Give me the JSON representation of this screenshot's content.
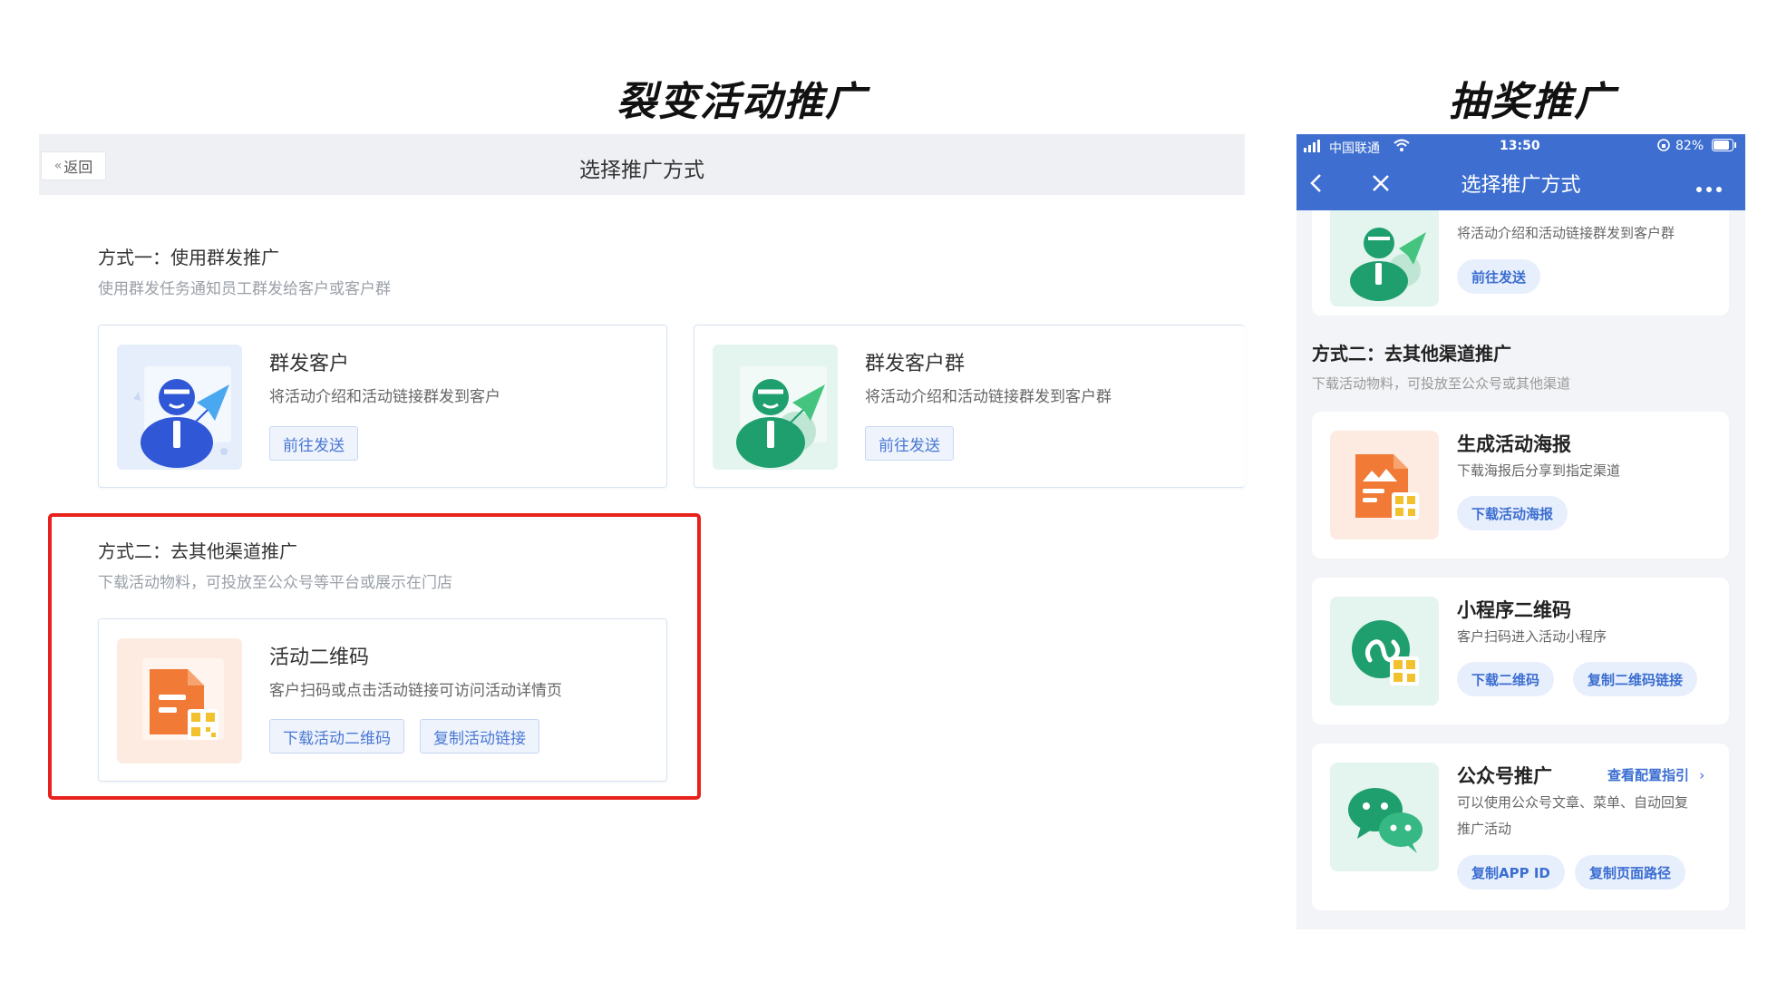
{
  "headings": {
    "left": "裂变活动推广",
    "right": "抽奖推广"
  },
  "web": {
    "back_label": "返回",
    "title": "选择推广方式",
    "method1": {
      "title": "方式一：使用群发推广",
      "desc": "使用群发任务通知员工群发给客户或客户群",
      "cards": [
        {
          "title": "群发客户",
          "desc": "将活动介绍和活动链接群发到客户",
          "button": "前往发送"
        },
        {
          "title": "群发客户群",
          "desc": "将活动介绍和活动链接群发到客户群",
          "button": "前往发送"
        }
      ]
    },
    "method2": {
      "title": "方式二：去其他渠道推广",
      "desc": "下载活动物料，可投放至公众号等平台或展示在门店",
      "card": {
        "title": "活动二维码",
        "desc": "客户扫码或点击活动链接可访问活动详情页",
        "buttons": [
          "下载活动二维码",
          "复制活动链接"
        ]
      }
    }
  },
  "phone": {
    "status": {
      "carrier": "中国联通",
      "time": "13:50",
      "battery": "82%"
    },
    "nav_title": "选择推广方式",
    "top_card": {
      "desc": "将活动介绍和活动链接群发到客户群",
      "button": "前往发送"
    },
    "section2": {
      "title": "方式二：去其他渠道推广",
      "desc": "下载活动物料，可投放至公众号或其他渠道"
    },
    "cards": [
      {
        "title": "生成活动海报",
        "desc": "下载海报后分享到指定渠道",
        "buttons": [
          "下载活动海报"
        ]
      },
      {
        "title": "小程序二维码",
        "desc": "客户扫码进入活动小程序",
        "buttons": [
          "下载二维码",
          "复制二维码链接"
        ]
      },
      {
        "title": "公众号推广",
        "link": "查看配置指引",
        "desc_line1": "可以使用公众号文章、菜单、自动回复",
        "desc_line2": "推广活动",
        "buttons": [
          "复制APP ID",
          "复制页面路径"
        ]
      }
    ]
  },
  "colors": {
    "accent": "#3e6fd0",
    "highlight": "#e8211c",
    "link": "#4a78d4"
  }
}
